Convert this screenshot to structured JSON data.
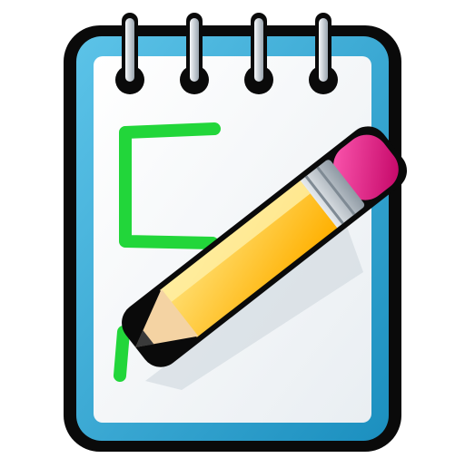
{
  "icon": {
    "name": "notepad-with-pencil-icon",
    "colors": {
      "outline": "#0a0a0a",
      "cover": "#1b8fbf",
      "cover_light": "#5cc3e8",
      "paper": "#ffffff",
      "paper_shade": "#e9eef2",
      "ring_metal": "#c8cfd6",
      "check_marks": "#22d63a",
      "pencil_body": "#ffc21a",
      "pencil_body_light": "#ffe27a",
      "pencil_ferrule": "#b9c1c8",
      "pencil_eraser": "#e0197a",
      "pencil_wood": "#f4d3a3",
      "pencil_lead": "#3a3a3a"
    },
    "ring_count": 4,
    "checkbox_count": 2
  }
}
